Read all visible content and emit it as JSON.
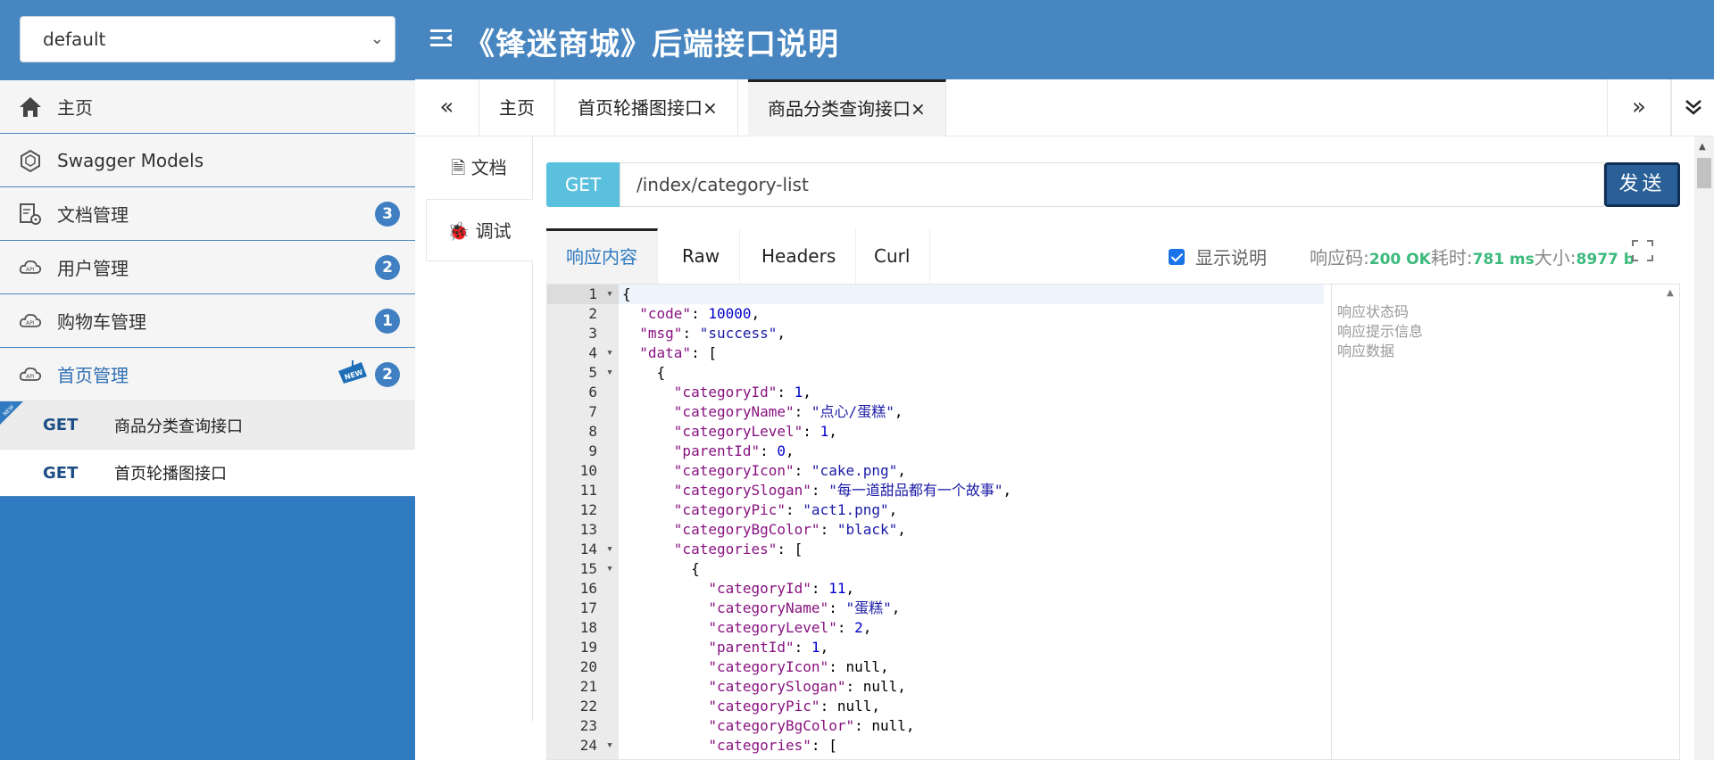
{
  "header": {
    "group_select": "default",
    "title": "《锋迷商城》后端接口说明"
  },
  "sidebar": {
    "items": [
      {
        "label": "主页",
        "icon": "home-icon"
      },
      {
        "label": "Swagger Models",
        "icon": "models-icon"
      },
      {
        "label": "文档管理",
        "icon": "doc-settings-icon",
        "badge": "3"
      },
      {
        "label": "用户管理",
        "icon": "api-cloud-icon",
        "badge": "2"
      },
      {
        "label": "购物车管理",
        "icon": "api-cloud-icon",
        "badge": "1"
      },
      {
        "label": "首页管理",
        "icon": "api-cloud-icon",
        "badge": "2",
        "new_tag": "NEW"
      }
    ],
    "sub_items": [
      {
        "method": "GET",
        "name": "商品分类查询接口"
      },
      {
        "method": "GET",
        "name": "首页轮播图接口"
      }
    ]
  },
  "tabs": {
    "prev": "«",
    "next": "»",
    "menu": "⌄",
    "items": [
      "主页",
      "首页轮播图接口×",
      "商品分类查询接口×"
    ]
  },
  "vtabs": {
    "doc": "文档",
    "debug": "调试"
  },
  "request": {
    "method": "GET",
    "url": "/index/category-list",
    "send": "发送"
  },
  "response": {
    "tabs": [
      "响应内容",
      "Raw",
      "Headers",
      "Curl"
    ],
    "show_desc": "显示说明",
    "code_label": "响应码:",
    "code_value": "200 OK",
    "time_label": "耗时:",
    "time_value": "781 ms",
    "size_label": "大小:",
    "size_value": "8977 b"
  },
  "notes": [
    "响应状态码",
    "响应提示信息",
    "响应数据"
  ],
  "colors": {
    "header_bg": "#4786c0",
    "sidebar_bg": "#2f7ac0",
    "method_badge": "#5bc0de",
    "send_button": "#2a5f97",
    "status_green": "#3cba7c"
  }
}
